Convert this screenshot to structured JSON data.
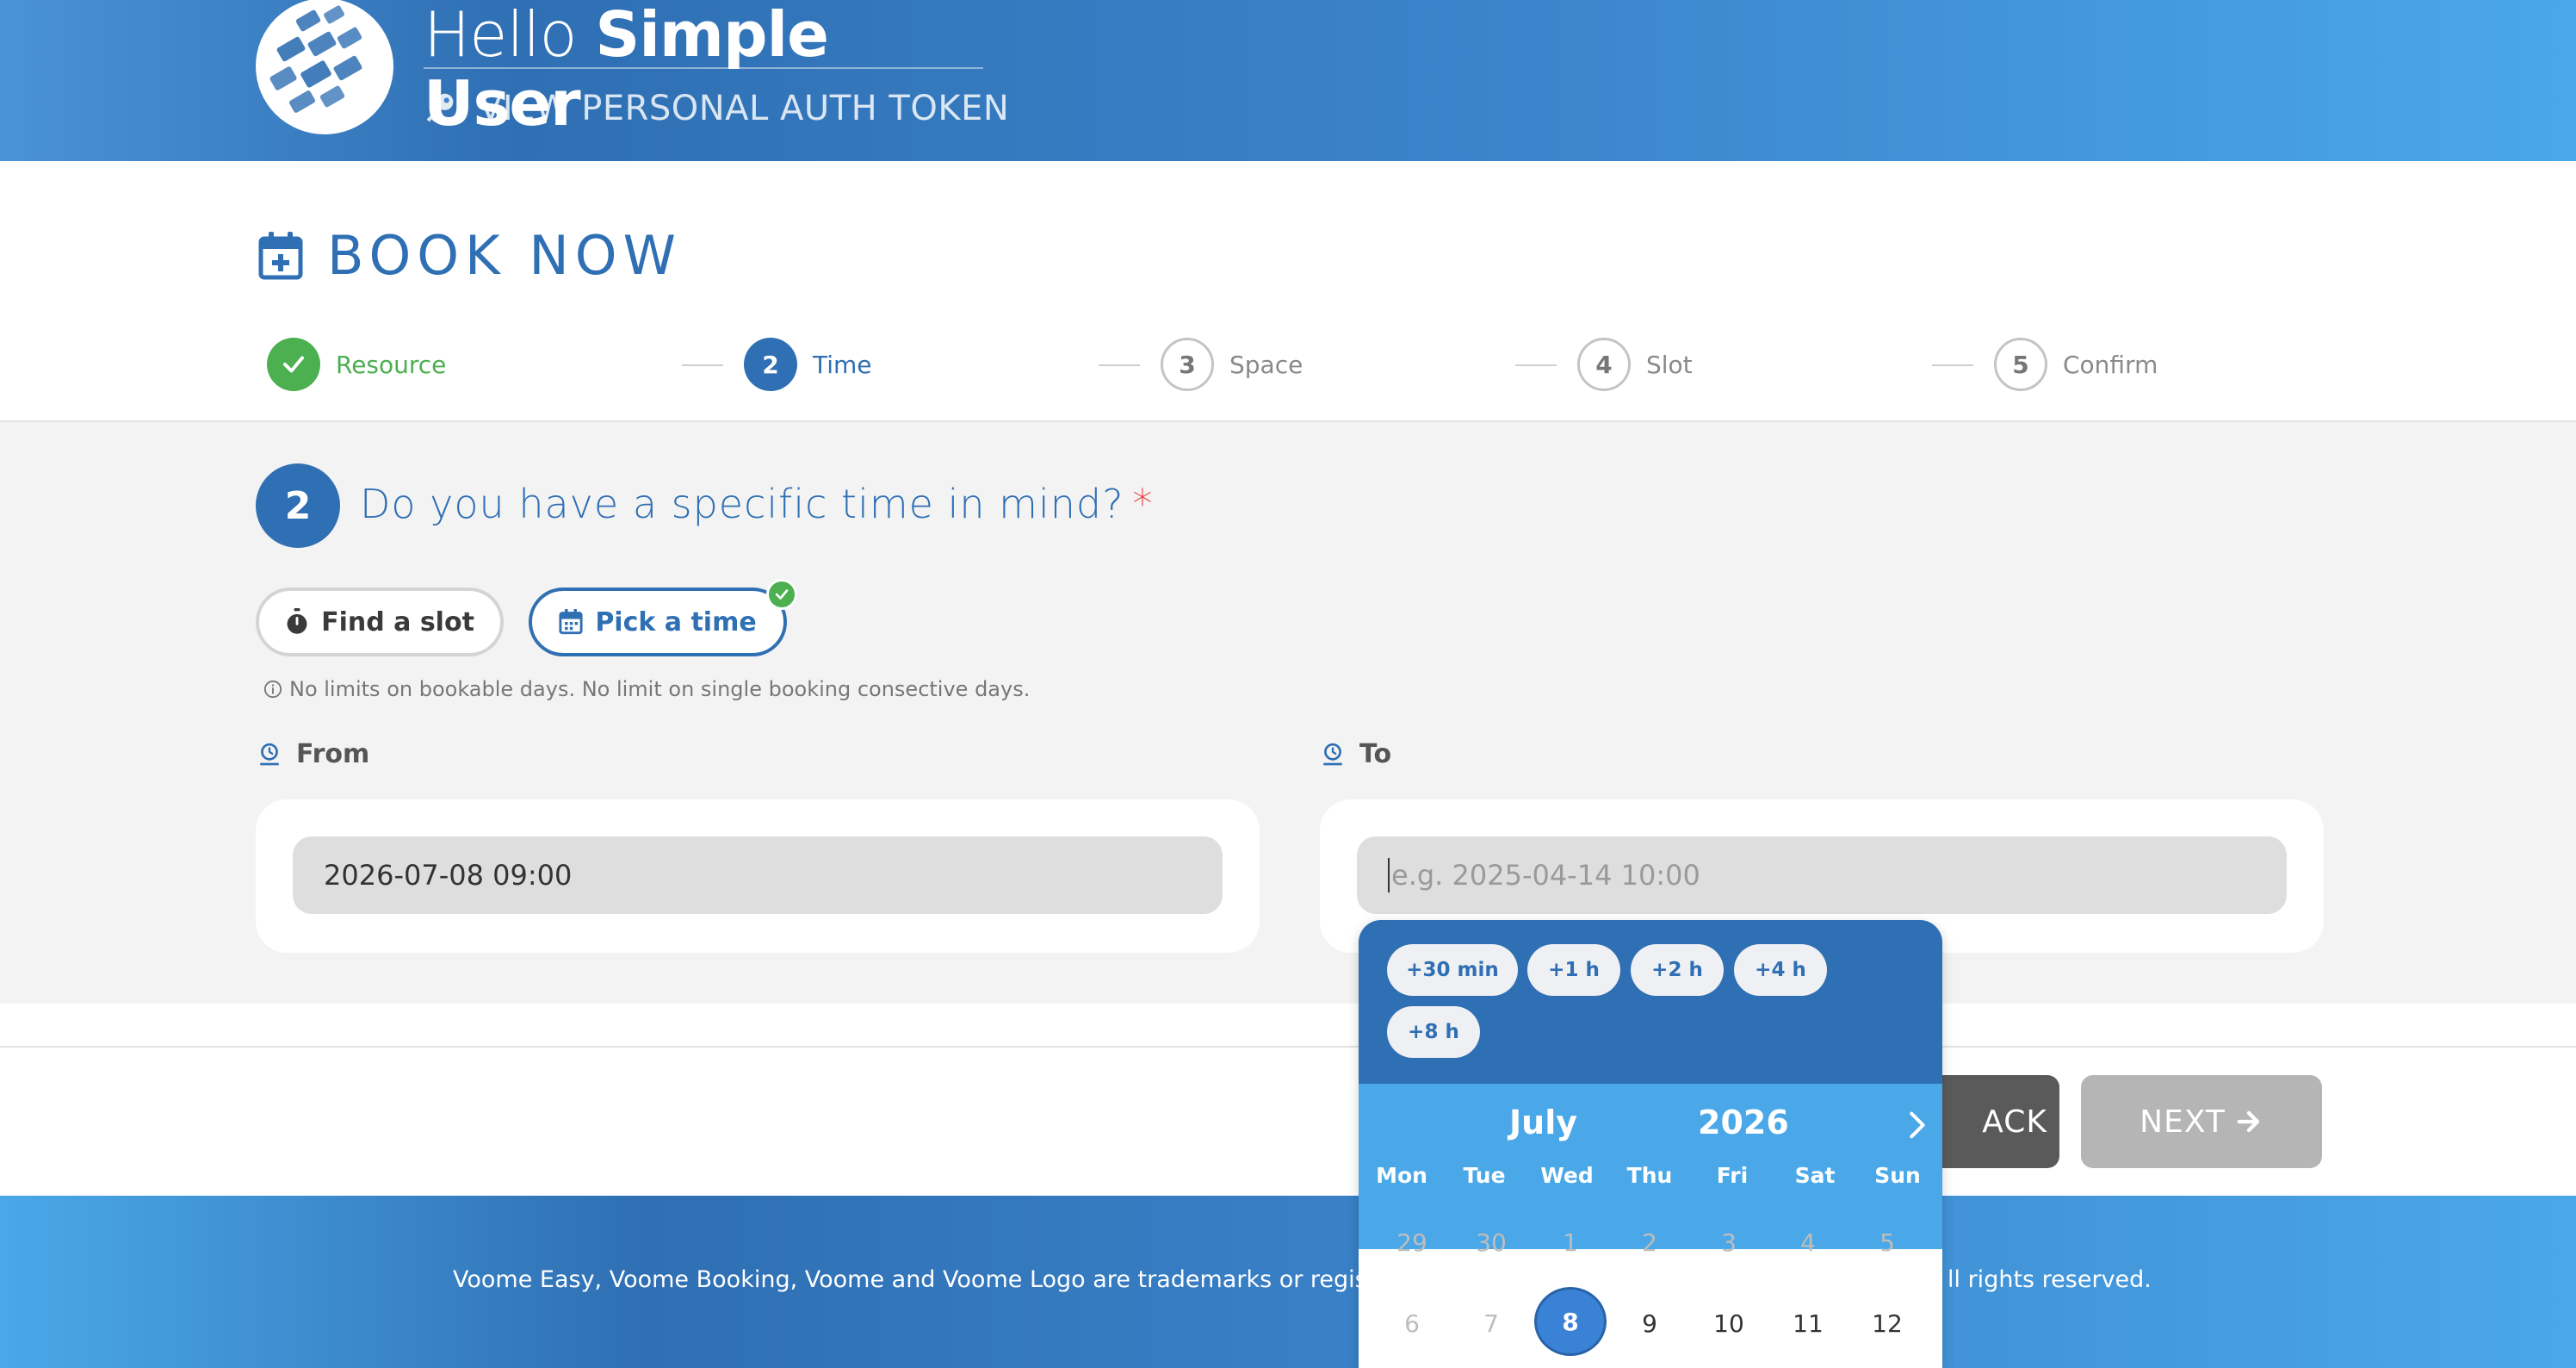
{
  "header": {
    "greeting": "Hello",
    "user_name": "Simple User",
    "auth_link": "VIEW PERSONAL AUTH TOKEN"
  },
  "page": {
    "title": "BOOK NOW"
  },
  "stepper": {
    "steps": [
      {
        "num": "1",
        "label": "Resource",
        "state": "done"
      },
      {
        "num": "2",
        "label": "Time",
        "state": "active"
      },
      {
        "num": "3",
        "label": "Space",
        "state": "todo"
      },
      {
        "num": "4",
        "label": "Slot",
        "state": "todo"
      },
      {
        "num": "5",
        "label": "Confirm",
        "state": "todo"
      }
    ]
  },
  "question": {
    "number": "2",
    "text": "Do you have a specific time in mind?",
    "required_mark": "*",
    "find_slot_label": "Find a slot",
    "pick_time_label": "Pick a time",
    "info": "No limits on bookable days. No limit on single booking consective days."
  },
  "from": {
    "label": "From",
    "value": "2026-07-08 09:00"
  },
  "to": {
    "label": "To",
    "placeholder": "e.g. 2025-04-14 10:00"
  },
  "buttons": {
    "back_visible": "ACK",
    "next": "NEXT"
  },
  "footer": {
    "text_left": "Voome Easy, Voome Booking, Voome and Voome Logo are trademarks or registered",
    "text_right": "ll rights reserved."
  },
  "picker": {
    "quick": [
      "+30 min",
      "+1 h",
      "+2 h",
      "+4 h",
      "+8 h"
    ],
    "month": "July",
    "year": "2026",
    "weekdays": [
      "Mon",
      "Tue",
      "Wed",
      "Thu",
      "Fri",
      "Sat",
      "Sun"
    ],
    "week1": [
      "29",
      "30",
      "1",
      "2",
      "3",
      "4",
      "5"
    ],
    "week2": [
      "6",
      "7",
      "8",
      "9",
      "10",
      "11",
      "12"
    ]
  },
  "colors": {
    "primary": "#2f6fb3",
    "accent_light": "#4aa8e8",
    "success": "#4caf50",
    "required": "#e53935"
  }
}
